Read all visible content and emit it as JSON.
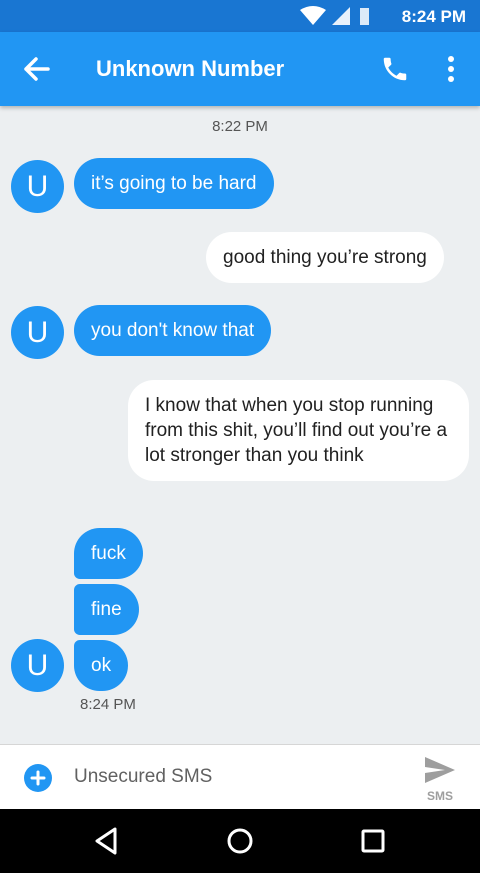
{
  "status_bar": {
    "time": "8:24 PM",
    "icons": [
      "wifi-icon",
      "signal-icon",
      "battery-icon"
    ]
  },
  "header": {
    "title": "Unknown Number",
    "back_icon": "arrow-left-icon",
    "call_icon": "phone-icon",
    "menu_icon": "more-vert-icon"
  },
  "conversation": {
    "timestamp_top": "8:22 PM",
    "avatar_letter": "U",
    "messages": [
      {
        "direction": "incoming",
        "text": "it’s going to be hard"
      },
      {
        "direction": "outgoing",
        "text": "good thing you’re strong"
      },
      {
        "direction": "incoming",
        "text": "you don't know that"
      },
      {
        "direction": "outgoing",
        "text": "I know that when you stop running from this shit, you’ll find out you’re a lot stronger than you think"
      },
      {
        "direction": "incoming",
        "text": "fuck"
      },
      {
        "direction": "incoming",
        "text": "fine"
      },
      {
        "direction": "incoming",
        "text": "ok"
      }
    ],
    "timestamp_bottom": "8:24 PM"
  },
  "composer": {
    "placeholder": "Unsecured SMS",
    "add_icon": "plus-circle-icon",
    "send_icon": "send-icon",
    "send_label": "SMS"
  },
  "nav_bar": {
    "icons": [
      "back-triangle-icon",
      "home-circle-icon",
      "recents-square-icon"
    ]
  },
  "colors": {
    "primary": "#2196f3",
    "primary_dark": "#1976d2",
    "background": "#eceff1",
    "outgoing_bubble": "#ffffff"
  }
}
